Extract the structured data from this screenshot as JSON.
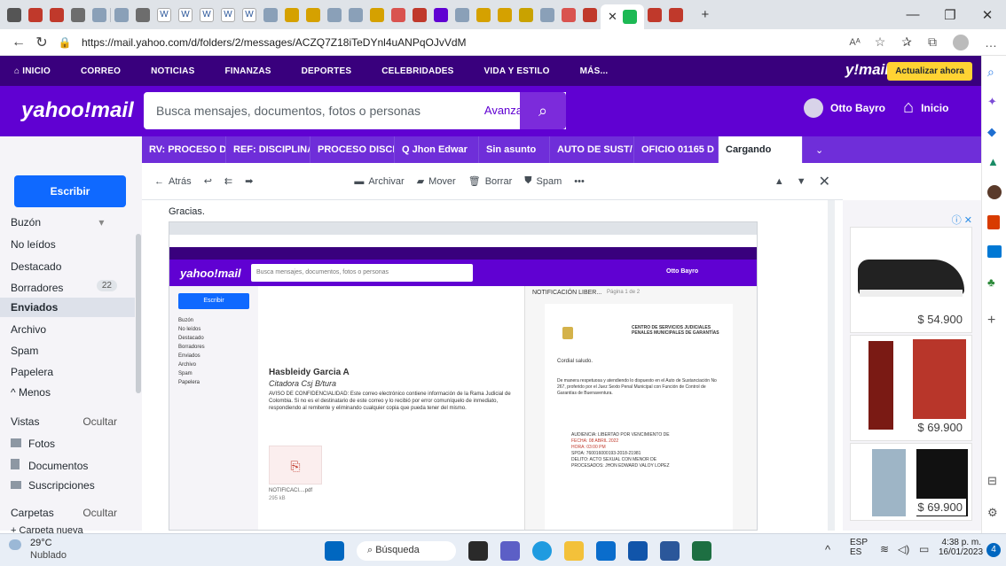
{
  "browser": {
    "url": "https://mail.yahoo.com/d/folders/2/messages/ACZQ7Z18iTeDYnl4uANPqOJvVdM",
    "reader_badge": "Aᴬ"
  },
  "topnav": {
    "items": [
      "INICIO",
      "CORREO",
      "NOTICIAS",
      "FINANZAS",
      "DEPORTES",
      "CELEBRIDADES",
      "VIDA Y ESTILO",
      "MÁS..."
    ],
    "brand": "y!mail",
    "upgrade_label": "Actualizar ahora"
  },
  "header": {
    "logo": "yahoo!mail",
    "search_placeholder": "Busca mensajes, documentos, fotos o personas",
    "advanced_label": "Avanzado",
    "user_name": "Otto Bayro",
    "home_label": "Inicio"
  },
  "message_tabs": [
    "RV: PROCESO D",
    "REF: DISCIPLINA",
    "PROCESO DISCI",
    "Q  Jhon Edwar",
    "Sin asunto",
    "AUTO DE SUST/",
    "OFICIO 01165 D",
    "Cargando"
  ],
  "sidebar": {
    "compose_label": "Escribir",
    "folders": [
      "Buzón",
      "No leídos",
      "Destacado",
      "Borradores",
      "Enviados",
      "Archivo",
      "Spam",
      "Papelera",
      "^ Menos"
    ],
    "drafts_count": "22",
    "views_label": "Vistas",
    "hide_label": "Ocultar",
    "views": [
      "Fotos",
      "Documentos",
      "Suscripciones"
    ],
    "folders_label": "Carpetas",
    "folders_hide": "Ocultar",
    "new_folder": "+ Carpeta nueva"
  },
  "toolbar": {
    "back_label": "Atrás",
    "archive_label": "Archivar",
    "move_label": "Mover",
    "delete_label": "Borrar",
    "spam_label": "Spam",
    "more_label": "•••"
  },
  "content": {
    "thanks": "Gracias.",
    "inner_signature_name": "Hasbleidy Garcia A",
    "inner_signature_role": "Citadora Csj B/tura",
    "inner_disclaimer": "AVISO DE CONFIDENCIALIDAD: Este correo electrónico contiene información de la Rama Judicial de Colombia. Si no es el destinatario de este correo y lo recibió por error comuníquelo de inmediato, respondiendo al remitente y eliminando cualquier copia que pueda tener del mismo.",
    "inner_attachment": "NOTIFICACI....pdf",
    "inner_attachment_size": "295 kB",
    "inner_pdf_header": "NOTIFICACIÓN LIBER...",
    "inner_pdf_page": "Página 1 de 2",
    "inner_pdf_center": "CENTRO DE SERVICIOS JUDICIALES PENALES MUNICIPALES DE GARANTÍAS",
    "inner_pdf_greeting": "Cordial saludo.",
    "inner_pdf_body": "De manera respetuosa y atendiendo lo dispuesto en el Auto de Sustanciación No 267, proferido por el Juez Sexto Penal Municipal con Función de Control de Garantías de Buenaventura.",
    "inner_pdf_fields": [
      [
        "AUDIENCIA:",
        "LIBERTAD POR VENCIMIENTO DE"
      ],
      [
        "FECHA:",
        "08 ABRIL 2022"
      ],
      [
        "HORA:",
        "03:00 PM"
      ],
      [
        "SPOA:",
        "760016000193-2018-21981"
      ],
      [
        "DELITO:",
        "ACTO SEXUAL CON MENOR DE"
      ],
      [
        "PROCESADOS:",
        "JHON EDWARD VALOY LOPEZ"
      ]
    ]
  },
  "ads": {
    "prices": [
      "$ 54.900",
      "$ 69.900",
      "$ 69.900"
    ]
  },
  "taskbar": {
    "weather_temp": "29°C",
    "weather_desc": "Nublado",
    "search_label": "Búsqueda",
    "lang": "ESP",
    "lang2": "ES",
    "time": "4:38 p. m.",
    "date": "16/01/2023",
    "notif_count": "4"
  }
}
